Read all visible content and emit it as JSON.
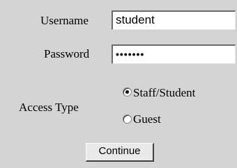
{
  "login_form": {
    "username_label": "Username",
    "username_value": "student",
    "password_label": "Password",
    "password_value": "•••••••",
    "access_type_label": "Access Type",
    "access_options": [
      {
        "label": "Staff/Student",
        "selected": true
      },
      {
        "label": "Guest",
        "selected": false
      }
    ],
    "continue_label": "Continue"
  }
}
